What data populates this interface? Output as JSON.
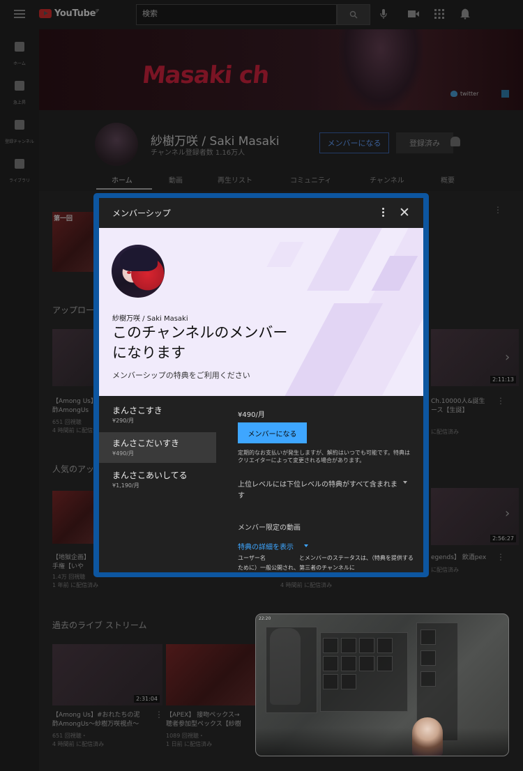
{
  "topbar": {
    "logo_text": "YouTube",
    "logo_sup": "JP",
    "search_placeholder": "検索"
  },
  "sidebar": {
    "items": [
      {
        "label": "ホーム",
        "icon": "home-icon"
      },
      {
        "label": "急上昇",
        "icon": "trending-icon"
      },
      {
        "label": "登録チャンネル",
        "icon": "subscriptions-icon"
      },
      {
        "label": "ライブラリ",
        "icon": "library-icon"
      }
    ]
  },
  "banner": {
    "title": "Masaki ch",
    "twitter": "twitter"
  },
  "channel": {
    "name": "紗樹万咲 / Saki Masaki",
    "subscribers": "チャンネル登録者数 1.16万人",
    "join_label": "メンバーになる",
    "subscribed_label": "登録済み",
    "tabs": [
      "ホーム",
      "動画",
      "再生リスト",
      "コミュニティ",
      "チャンネル",
      "概要"
    ]
  },
  "background": {
    "sections": [
      {
        "title": "アップロード"
      },
      {
        "title": "人気のアップ"
      },
      {
        "title": "過去のライブ ストリーム"
      }
    ],
    "first_thumb_label": "第一回",
    "videos": [
      {
        "title": "【Among Us】",
        "title2": "酢AmongUs",
        "meta1": "651 回視聴",
        "meta2": "4 時間前 に配信済み"
      },
      {
        "title": "【地獄企画】",
        "title2": "手権【いや",
        "meta1": "1.4万 回視聴",
        "meta2": "1 年前 に配信済み"
      },
      {
        "title": "【Among Us】#おれたちの泥",
        "title2": "酢AmongUs～紗樹万咲視点～",
        "meta1": "651 回視聴・",
        "meta2": "4 時間前 に配信済み",
        "duration": "2:31:04"
      },
      {
        "title": "【APEX】 接吻ペックス→",
        "title2": "聴者参加型ペックス【紗樹",
        "meta1": "1089 回視聴・",
        "meta2": "1 日前 に配信済み"
      },
      {
        "title": "Ch.10000人&誕生",
        "title2": "ース【生誕】",
        "meta2": "に配信済み",
        "duration": "2:11:13"
      },
      {
        "title": "egends】 飲酒pex",
        "meta2": "に配信済み",
        "duration": "2:56:27"
      }
    ],
    "mid_meta": "4 時間前 に配信済み"
  },
  "modal": {
    "title": "メンバーシップ",
    "channel_name": "紗樹万咲 / Saki Masaki",
    "headline": "このチャンネルのメンバーになります",
    "headline_line1": "このチャンネルのメンバー",
    "headline_line2": "になります",
    "subtitle": "メンバーシップの特典をご利用ください",
    "tiers": [
      {
        "name": "まんさこすき",
        "price": "¥290/月"
      },
      {
        "name": "まんさこだいすき",
        "price": "¥490/月",
        "selected": true
      },
      {
        "name": "まんさこあいしてる",
        "price": "¥1,190/月"
      }
    ],
    "detail": {
      "price": "¥490/月",
      "join_label": "メンバーになる",
      "note": "定期的なお支払いが発生しますが、解約はいつでも可能です。特典はクリエイターによって変更される場合があります。",
      "level_note": "上位レベルには下位レベルの特典がすべて含まれます",
      "member_video": "メンバー限定の動画",
      "details_link": "特典の詳細を表示",
      "privacy": "ユーザー名　　　　　　とメンバーのステータスは、（特典を提供するために）一般公開され、第三者のチャンネルに"
    },
    "colors": {
      "accent": "#3ea6ff",
      "hero_bg": "#f1ebfb",
      "frame": "#0d56a0"
    }
  },
  "mini_player": {
    "time_label": "22:20"
  }
}
